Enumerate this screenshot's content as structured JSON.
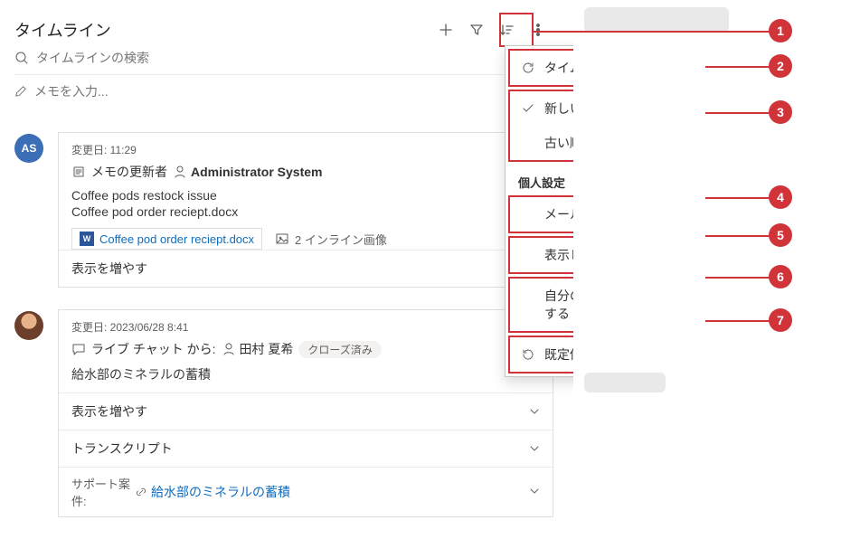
{
  "header": {
    "title": "タイムライン",
    "search_placeholder": "タイムラインの検索",
    "note_placeholder": "メモを入力..."
  },
  "entries": [
    {
      "timestamp_label": "変更日: 11:29",
      "title_prefix": "メモの更新者",
      "updater": "Administrator System",
      "body1": "Coffee pods restock issue",
      "body2": "Coffee pod order reciept.docx",
      "attachment": "Coffee pod order reciept.docx",
      "inline_images": "2 インライン画像",
      "expand": "表示を増やす",
      "avatar": "AS"
    },
    {
      "timestamp_label": "変更日: 2023/06/28 8:41",
      "chat_prefix": "ライブ チャット から:",
      "chat_user": "田村 夏希",
      "status_badge": "クローズ済み",
      "body1": "給水部のミネラルの蓄積",
      "expand": "表示を増やす",
      "transcript": "トランスクリプト",
      "case_label": "サポート案件:",
      "case_link": "給水部のミネラルの蓄積"
    }
  ],
  "menu": {
    "refresh": "タイムラインの更新",
    "sort_new": "新しい順に並べ替え",
    "sort_old": "古い順に並べ替え",
    "section": "個人設定",
    "email_intent": "メールの表示目的",
    "layout": "表示レイアウト",
    "remember_filter": "自分のフィルターを記憶する",
    "reset": "既定値にリセット"
  },
  "annotations": [
    "1",
    "2",
    "3",
    "4",
    "5",
    "6",
    "7"
  ]
}
